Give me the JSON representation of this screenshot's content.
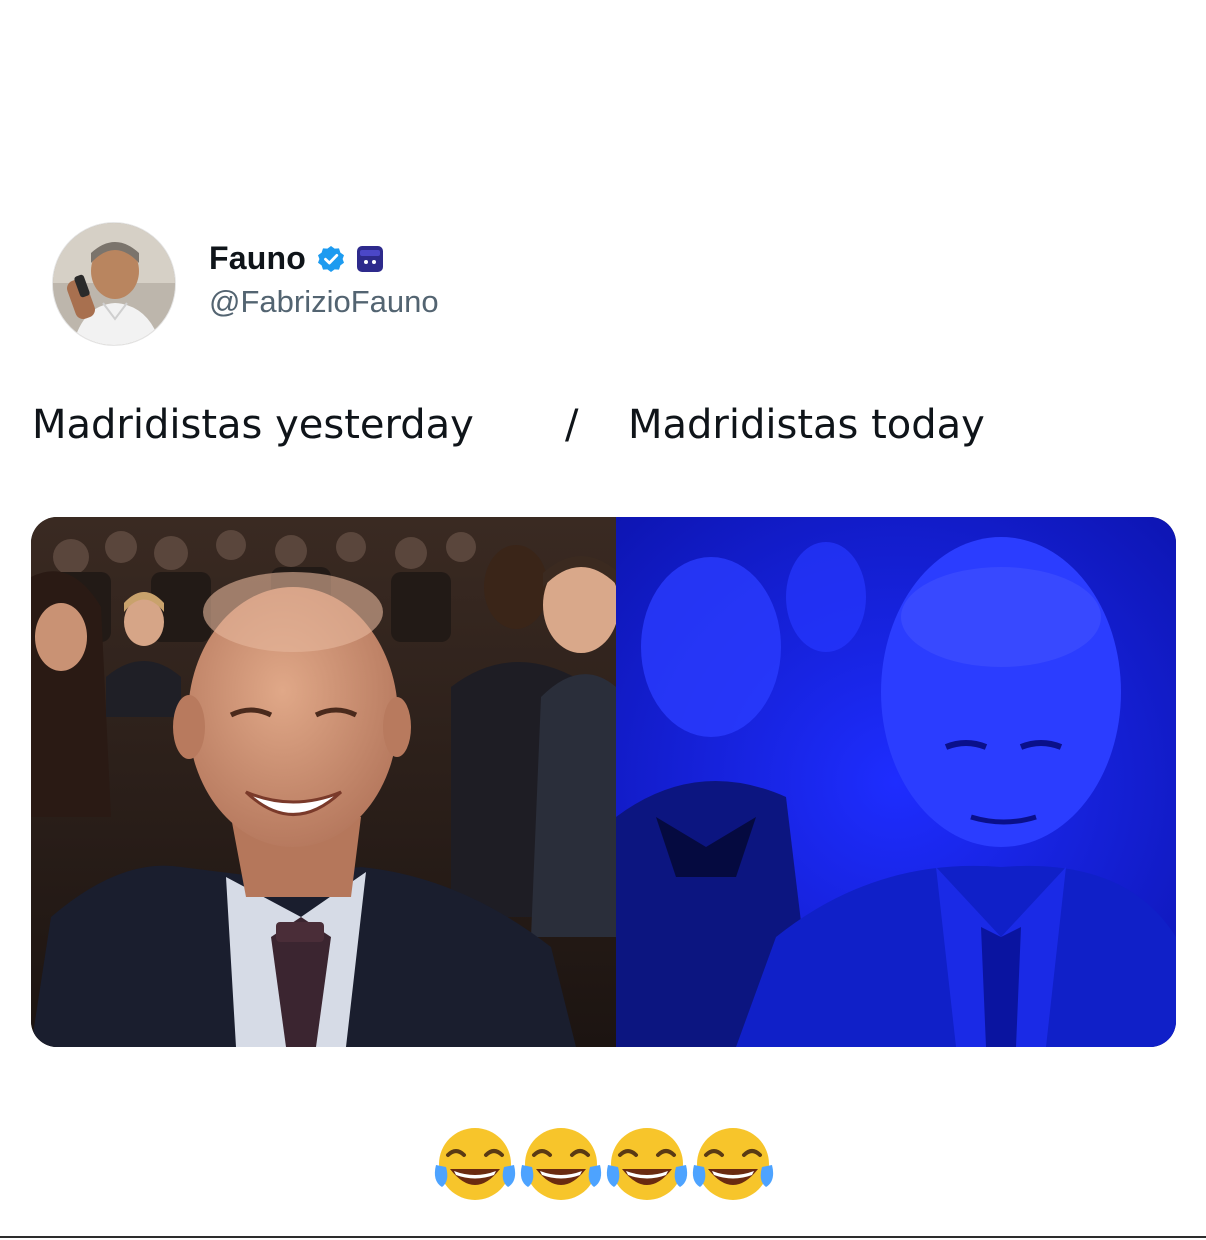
{
  "tweet": {
    "display_name": "Fauno",
    "handle": "@FabrizioFauno",
    "verified_icon": "verified-badge-icon",
    "affiliation_icon": "affiliation-badge-icon",
    "avatar_icon": "profile-avatar"
  },
  "caption": {
    "left": "Madridistas yesterday",
    "separator": "/",
    "right": "Madridistas today"
  },
  "media": {
    "left_image": "smiling-man-in-audience-photo",
    "right_image": "blue-lit-man-in-audience-photo"
  },
  "reactions": [
    "😂",
    "😂",
    "😂",
    "😂"
  ],
  "colors": {
    "verified_blue": "#1d9bf0",
    "handle_gray": "#536471",
    "affiliation_purple": "#2d2a8c",
    "right_panel_blue": "#1a2cff"
  }
}
